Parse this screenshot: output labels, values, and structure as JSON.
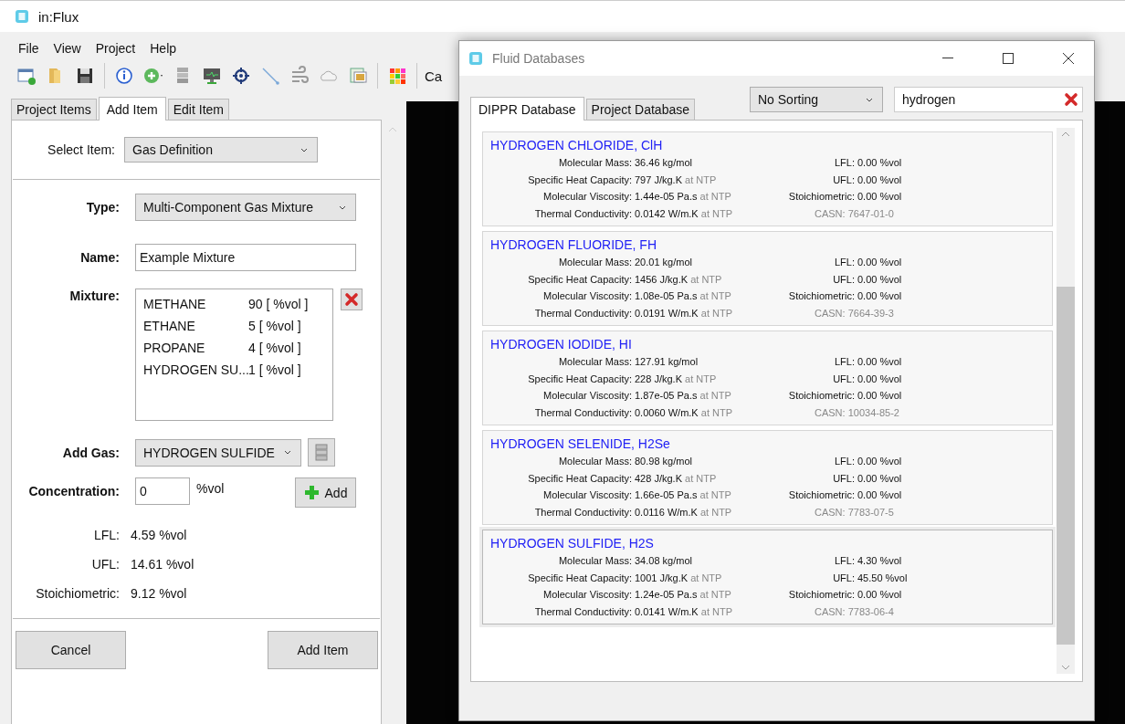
{
  "window": {
    "title": "in:Flux"
  },
  "menu": [
    "File",
    "View",
    "Project",
    "Help"
  ],
  "toolbar": {
    "cut_label": "Ca"
  },
  "tabs": [
    {
      "label": "Project Items",
      "selected": false
    },
    {
      "label": "Add Item",
      "selected": true
    },
    {
      "label": "Edit Item",
      "selected": false
    }
  ],
  "form": {
    "select_item": {
      "label": "Select Item:",
      "value": "Gas Definition"
    },
    "type": {
      "label": "Type:",
      "value": "Multi-Component Gas Mixture"
    },
    "name": {
      "label": "Name:",
      "value": "Example Mixture"
    },
    "mixture": {
      "label": "Mixture:",
      "items": [
        {
          "name": "METHANE",
          "amount": "90 [ %vol ]"
        },
        {
          "name": "ETHANE",
          "amount": "5 [ %vol ]"
        },
        {
          "name": "PROPANE",
          "amount": "4 [ %vol ]"
        },
        {
          "name": "HYDROGEN SU...",
          "amount": "1 [ %vol ]"
        }
      ]
    },
    "add_gas": {
      "label": "Add Gas:",
      "value": "HYDROGEN SULFIDE"
    },
    "concentration": {
      "label": "Concentration:",
      "value": "0",
      "unit": "%vol"
    },
    "add_button": "Add",
    "results": [
      {
        "label": "LFL:",
        "value": "4.59 %vol"
      },
      {
        "label": "UFL:",
        "value": "14.61 %vol"
      },
      {
        "label": "Stoichiometric:",
        "value": "9.12 %vol"
      }
    ],
    "buttons": [
      "Cancel",
      "Add Item"
    ]
  },
  "dialog": {
    "title": "Fluid Databases",
    "tabs": [
      {
        "label": "DIPPR Database",
        "selected": true
      },
      {
        "label": "Project Database",
        "selected": false
      }
    ],
    "sorting": "No Sorting",
    "search": "hydrogen",
    "cards": [
      {
        "title": "HYDROGEN CHLORIDE, ClH",
        "selected": false,
        "props": [
          {
            "label": "Molecular Mass:",
            "value": "36.46 kg/mol"
          },
          {
            "label": "Specific Heat Capacity:",
            "value": "797 J/kg.K",
            "note": "at NTP"
          },
          {
            "label": "Molecular Viscosity:",
            "value": "1.44e-05 Pa.s",
            "note": "at NTP"
          },
          {
            "label": "Thermal Conductivity:",
            "value": "0.0142 W/m.K",
            "note": "at NTP"
          }
        ],
        "limits": [
          {
            "label": "LFL:",
            "value": "0.00 %vol"
          },
          {
            "label": "UFL:",
            "value": "0.00 %vol"
          },
          {
            "label": "Stoichiometric:",
            "value": "0.00 %vol"
          }
        ],
        "casn": "CASN: 7647-01-0"
      },
      {
        "title": "HYDROGEN FLUORIDE, FH",
        "selected": false,
        "props": [
          {
            "label": "Molecular Mass:",
            "value": "20.01 kg/mol"
          },
          {
            "label": "Specific Heat Capacity:",
            "value": "1456 J/kg.K",
            "note": "at NTP"
          },
          {
            "label": "Molecular Viscosity:",
            "value": "1.08e-05 Pa.s",
            "note": "at NTP"
          },
          {
            "label": "Thermal Conductivity:",
            "value": "0.0191 W/m.K",
            "note": "at NTP"
          }
        ],
        "limits": [
          {
            "label": "LFL:",
            "value": "0.00 %vol"
          },
          {
            "label": "UFL:",
            "value": "0.00 %vol"
          },
          {
            "label": "Stoichiometric:",
            "value": "0.00 %vol"
          }
        ],
        "casn": "CASN: 7664-39-3"
      },
      {
        "title": "HYDROGEN IODIDE, HI",
        "selected": false,
        "props": [
          {
            "label": "Molecular Mass:",
            "value": "127.91 kg/mol"
          },
          {
            "label": "Specific Heat Capacity:",
            "value": "228 J/kg.K",
            "note": "at NTP"
          },
          {
            "label": "Molecular Viscosity:",
            "value": "1.87e-05 Pa.s",
            "note": "at NTP"
          },
          {
            "label": "Thermal Conductivity:",
            "value": "0.0060 W/m.K",
            "note": "at NTP"
          }
        ],
        "limits": [
          {
            "label": "LFL:",
            "value": "0.00 %vol"
          },
          {
            "label": "UFL:",
            "value": "0.00 %vol"
          },
          {
            "label": "Stoichiometric:",
            "value": "0.00 %vol"
          }
        ],
        "casn": "CASN: 10034-85-2"
      },
      {
        "title": "HYDROGEN SELENIDE, H2Se",
        "selected": false,
        "props": [
          {
            "label": "Molecular Mass:",
            "value": "80.98 kg/mol"
          },
          {
            "label": "Specific Heat Capacity:",
            "value": "428 J/kg.K",
            "note": "at NTP"
          },
          {
            "label": "Molecular Viscosity:",
            "value": "1.66e-05 Pa.s",
            "note": "at NTP"
          },
          {
            "label": "Thermal Conductivity:",
            "value": "0.0116 W/m.K",
            "note": "at NTP"
          }
        ],
        "limits": [
          {
            "label": "LFL:",
            "value": "0.00 %vol"
          },
          {
            "label": "UFL:",
            "value": "0.00 %vol"
          },
          {
            "label": "Stoichiometric:",
            "value": "0.00 %vol"
          }
        ],
        "casn": "CASN: 7783-07-5"
      },
      {
        "title": "HYDROGEN SULFIDE, H2S",
        "selected": true,
        "props": [
          {
            "label": "Molecular Mass:",
            "value": "34.08 kg/mol"
          },
          {
            "label": "Specific Heat Capacity:",
            "value": "1001 J/kg.K",
            "note": "at NTP"
          },
          {
            "label": "Molecular Viscosity:",
            "value": "1.24e-05 Pa.s",
            "note": "at NTP"
          },
          {
            "label": "Thermal Conductivity:",
            "value": "0.0141 W/m.K",
            "note": "at NTP"
          }
        ],
        "limits": [
          {
            "label": "LFL:",
            "value": "4.30 %vol"
          },
          {
            "label": "UFL:",
            "value": "45.50 %vol"
          },
          {
            "label": "Stoichiometric:",
            "value": "0.00 %vol"
          }
        ],
        "casn": "CASN: 7783-06-4"
      }
    ]
  }
}
